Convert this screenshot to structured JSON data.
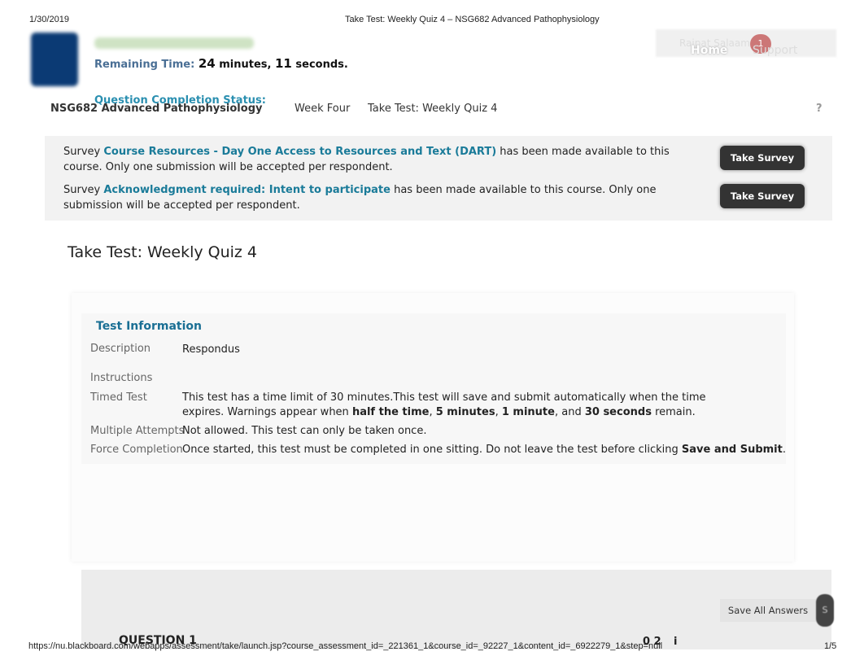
{
  "print_header": {
    "date": "1/30/2019",
    "title": "Take Test: Weekly Quiz 4 – NSG682 Advanced Pathophysiology"
  },
  "print_footer": {
    "url": "https://nu.blackboard.com/webapps/assessment/take/launch.jsp?course_assessment_id=_221361_1&course_id=_92227_1&content_id=_6922279_1&step=null",
    "page": "1/5"
  },
  "timer": {
    "label": "Remaining Time:",
    "minutes": "24",
    "minutes_unit": "minutes,",
    "seconds": "11",
    "seconds_unit": "seconds."
  },
  "completion_status": "Question Completion Status:",
  "topnav": {
    "user": "Rajpat Salaam",
    "badge": "1",
    "home": "Home",
    "support": "Support"
  },
  "breadcrumb": [
    "NSG682 Advanced Pathophysiology",
    "Week Four",
    "Take Test: Weekly Quiz 4"
  ],
  "help": "?",
  "surveys": [
    {
      "prefix": "Survey",
      "link": "Course Resources - Day One Access to Resources and Text (DART)",
      "suffix": " has been made available to this course. Only one submission will be accepted per respondent.",
      "button": "Take Survey"
    },
    {
      "prefix": "Survey",
      "link": "Acknowledgment required: Intent to participate",
      "suffix": " has been made available to this course. Only one submission will be accepted per respondent.",
      "button": "Take Survey"
    }
  ],
  "page_title": "Take Test: Weekly Quiz 4",
  "test_info": {
    "heading": "Test Information",
    "description_label": "Description",
    "description": "Respondus",
    "instructions_label": "Instructions",
    "timed_label": "Timed Test",
    "timed_1": "This test has a time limit of 30 minutes.This test will save and submit automatically when the time expires. Warnings appear when ",
    "timed_b1": "half the time",
    "timed_c1": ", ",
    "timed_b2": "5 minutes",
    "timed_c2": ", ",
    "timed_b3": "1 minute",
    "timed_c3": ", and ",
    "timed_b4": "30 seconds",
    "timed_end": " remain.",
    "attempts_label": "Multiple Attempts",
    "attempts": "Not allowed. This test can only be taken once.",
    "force_label": "Force Completion",
    "force": "Once started, this test must be completed in one sitting. Do not leave the test before clicking ",
    "force_b": "Save and Submit",
    "force_end": "."
  },
  "footer": {
    "save_all": "Save All Answers",
    "submit": "S",
    "question": "QUESTION 1",
    "points": "0 2",
    "info": "i"
  }
}
